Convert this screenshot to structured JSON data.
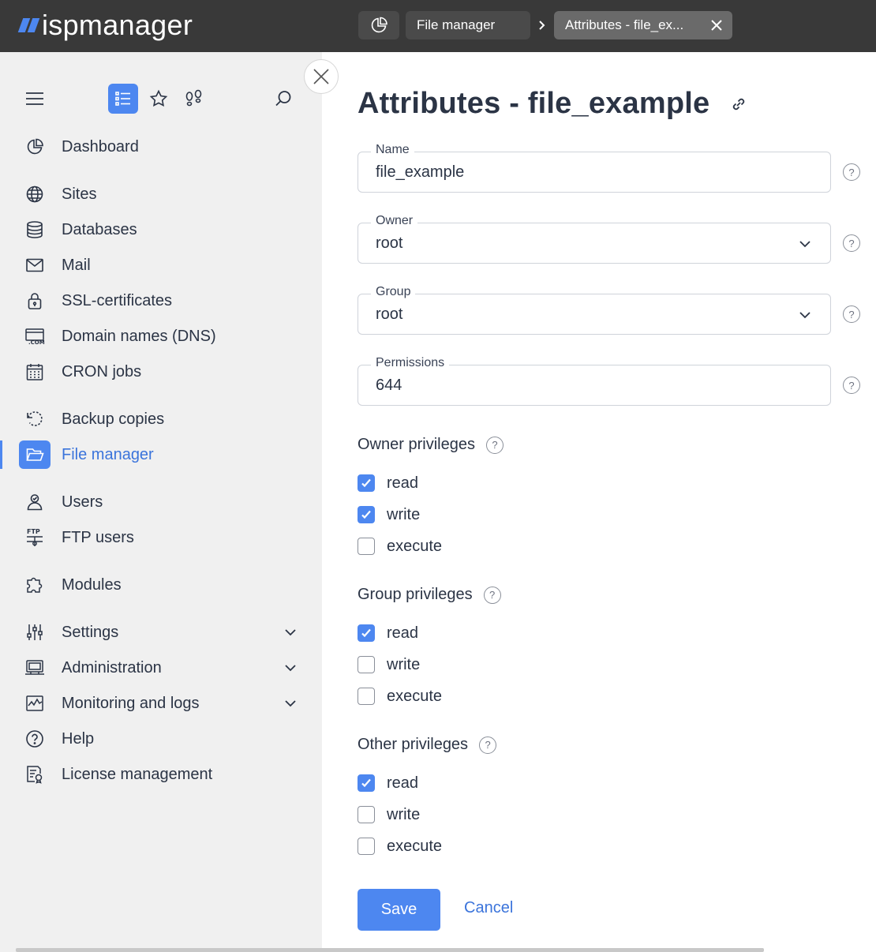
{
  "app": {
    "logo_text": "ispmanager"
  },
  "tabs": {
    "file_manager": "File manager",
    "attributes": "Attributes - file_ex..."
  },
  "sidebar": {
    "items": [
      {
        "label": "Dashboard"
      },
      {
        "label": "Sites"
      },
      {
        "label": "Databases"
      },
      {
        "label": "Mail"
      },
      {
        "label": "SSL-certificates"
      },
      {
        "label": "Domain names (DNS)"
      },
      {
        "label": "CRON jobs"
      },
      {
        "label": "Backup copies"
      },
      {
        "label": "File manager"
      },
      {
        "label": "Users"
      },
      {
        "label": "FTP users"
      },
      {
        "label": "Modules"
      },
      {
        "label": "Settings"
      },
      {
        "label": "Administration"
      },
      {
        "label": "Monitoring and logs"
      },
      {
        "label": "Help"
      },
      {
        "label": "License management"
      }
    ]
  },
  "form": {
    "title": "Attributes - file_example",
    "name": {
      "label": "Name",
      "value": "file_example"
    },
    "owner": {
      "label": "Owner",
      "value": "root"
    },
    "group": {
      "label": "Group",
      "value": "root"
    },
    "permissions": {
      "label": "Permissions",
      "value": "644"
    },
    "owner_privileges": {
      "title": "Owner privileges",
      "read": "read",
      "write": "write",
      "execute": "execute",
      "read_checked": true,
      "write_checked": true,
      "execute_checked": false
    },
    "group_privileges": {
      "title": "Group privileges",
      "read": "read",
      "write": "write",
      "execute": "execute",
      "read_checked": true,
      "write_checked": false,
      "execute_checked": false
    },
    "other_privileges": {
      "title": "Other privileges",
      "read": "read",
      "write": "write",
      "execute": "execute",
      "read_checked": true,
      "write_checked": false,
      "execute_checked": false
    },
    "help_glyph": "?",
    "save": "Save",
    "cancel": "Cancel"
  },
  "colors": {
    "accent": "#4d87f0",
    "topbar": "#393939",
    "sidebar": "#f0f0f0"
  }
}
